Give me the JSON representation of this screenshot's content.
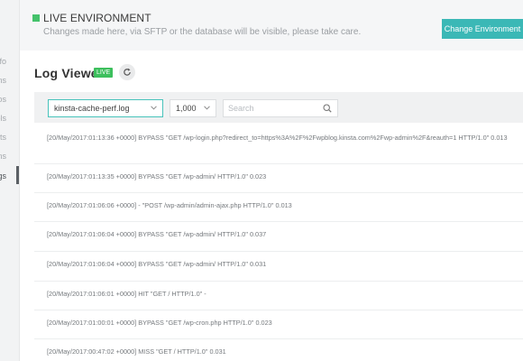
{
  "sidebar": {
    "items": [
      {
        "label": "fo"
      },
      {
        "label": "ns"
      },
      {
        "label": "os"
      },
      {
        "label": "ols"
      },
      {
        "label": "cts"
      },
      {
        "label": "ns"
      },
      {
        "label": "gs",
        "active": true
      }
    ]
  },
  "banner": {
    "title": "LIVE ENVIRONMENT",
    "description": "Changes made here, via SFTP or the database will be visible, please take care.",
    "change_button": "Change Environment"
  },
  "log_viewer": {
    "title": "Log Viewer",
    "badge": "LIVE",
    "refresh_icon": "refresh-icon",
    "file_select": "kinsta-cache-perf.log",
    "lines_select": "1,000",
    "search_placeholder": "Search",
    "entries": [
      "[20/May/2017:01:13:36 +0000] BYPASS \"GET /wp-login.php?redirect_to=https%3A%2F%2Fwpblog.kinsta.com%2Fwp-admin%2F&reauth=1 HTTP/1.0\" 0.013",
      "[20/May/2017:01:13:35 +0000] BYPASS \"GET /wp-admin/ HTTP/1.0\" 0.023",
      "[20/May/2017:01:06:06 +0000] - \"POST /wp-admin/admin-ajax.php HTTP/1.0\" 0.013",
      "[20/May/2017:01:06:04 +0000] BYPASS \"GET /wp-admin/ HTTP/1.0\" 0.037",
      "[20/May/2017:01:06:04 +0000] BYPASS \"GET /wp-admin/ HTTP/1.0\" 0.031",
      "[20/May/2017:01:06:01 +0000] HIT \"GET / HTTP/1.0\" -",
      "[20/May/2017:01:00:01 +0000] BYPASS \"GET /wp-cron.php HTTP/1.0\" 0.023",
      "[20/May/2017:00:47:02 +0000] MISS \"GET / HTTP/1.0\" 0.031"
    ]
  },
  "colors": {
    "accent": "#3bb8b6",
    "live_green": "#44c26b"
  }
}
